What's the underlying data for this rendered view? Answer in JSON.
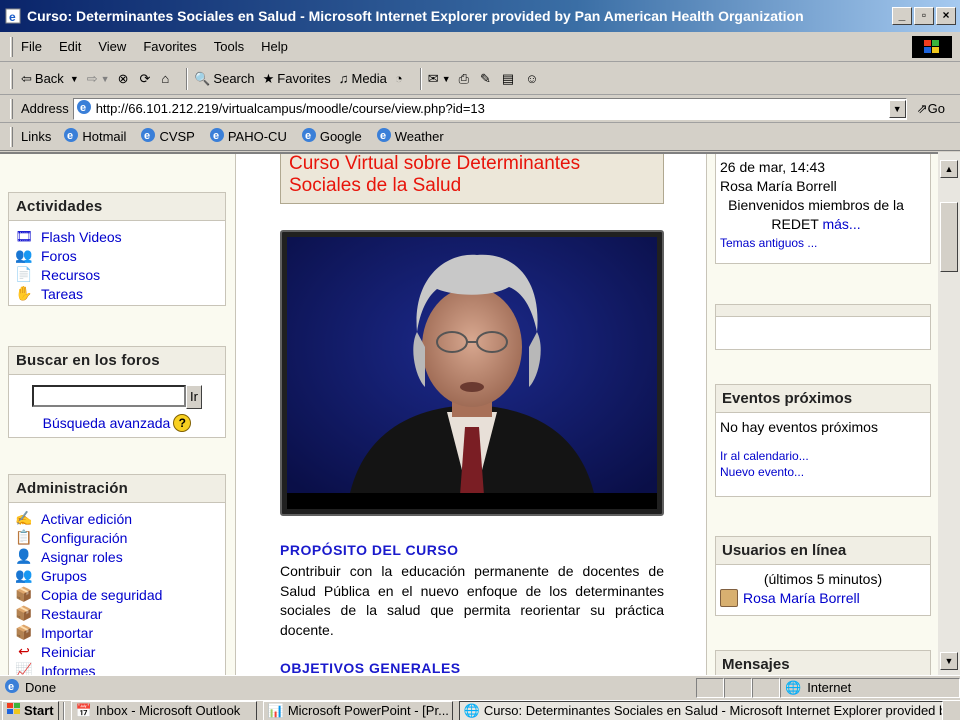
{
  "window": {
    "title": "Curso: Determinantes Sociales en Salud - Microsoft Internet Explorer provided by Pan American Health Organization",
    "buttons": [
      "_",
      "▫",
      "×"
    ]
  },
  "menu": [
    "File",
    "Edit",
    "View",
    "Favorites",
    "Tools",
    "Help"
  ],
  "toolbar": {
    "back": "Back",
    "search": "Search",
    "favorites": "Favorites",
    "media": "Media"
  },
  "address": {
    "label": "Address",
    "url": "http://66.101.212.219/virtualcampus/moodle/course/view.php?id=13",
    "go": "Go"
  },
  "links": {
    "label": "Links",
    "items": [
      "Hotmail",
      "CVSP",
      "PAHO-CU",
      "Google",
      "Weather"
    ]
  },
  "left": {
    "actividades": {
      "title": "Actividades",
      "items": [
        "Flash Videos",
        "Foros",
        "Recursos",
        "Tareas"
      ]
    },
    "buscar": {
      "title": "Buscar en los foros",
      "button": "Ir",
      "advanced": "Búsqueda avanzada",
      "help": "?"
    },
    "admin": {
      "title": "Administración",
      "items": [
        "Activar edición",
        "Configuración",
        "Asignar roles",
        "Grupos",
        "Copia de seguridad",
        "Restaurar",
        "Importar",
        "Reiniciar",
        "Informes"
      ]
    }
  },
  "center": {
    "banner": "Curso Virtual sobre Determinantes Sociales de la Salud",
    "purpose_title": "PROPÓSITO DEL CURSO",
    "purpose_text": "Contribuir con la educación permanente de docentes de Salud Pública en el nuevo enfoque de los determinantes sociales de la salud que permita reorientar su práctica docente.",
    "objectives_title": "OBJETIVOS GENERALES"
  },
  "right": {
    "news": {
      "date": "26 de mar, 14:43",
      "author": "Rosa María Borrell",
      "text": "Bienvenidos miembros de la REDET",
      "more": "más...",
      "older": "Temas antiguos ..."
    },
    "events": {
      "title": "Eventos próximos",
      "none": "No hay eventos próximos",
      "calendar": "Ir al calendario...",
      "new": "Nuevo evento..."
    },
    "online": {
      "title": "Usuarios en línea",
      "period": "(últimos 5 minutos)",
      "user": "Rosa María Borrell"
    },
    "messages": {
      "title": "Mensajes"
    }
  },
  "status": {
    "text": "Done",
    "zone": "Internet"
  },
  "taskbar": {
    "start": "Start",
    "tasks": [
      "Inbox - Microsoft Outlook",
      "Microsoft PowerPoint - [Pr...",
      "Curso: Determinantes Sociales en Salud - Microsoft Internet Explorer provided by Pan American Health Organization"
    ]
  }
}
